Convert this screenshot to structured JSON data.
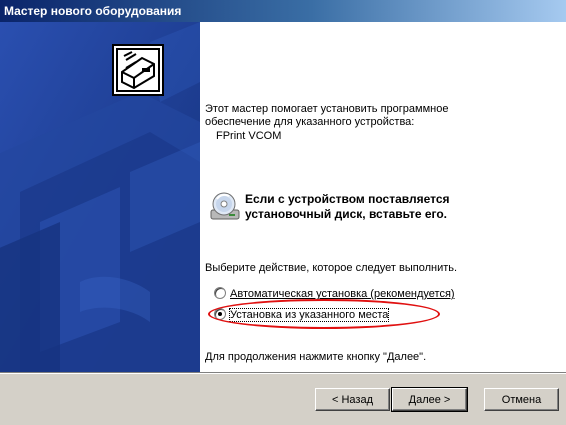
{
  "window": {
    "title": "Мастер нового оборудования"
  },
  "intro": {
    "line1": "Этот мастер помогает установить программное",
    "line2": "обеспечение для указанного устройства:",
    "device": "FPrint VCOM"
  },
  "disk_hint": {
    "line1": "Если с устройством поставляется",
    "line2": "установочный диск, вставьте его."
  },
  "choose_prompt": "Выберите действие, которое следует выполнить.",
  "options": [
    {
      "label": "Автоматическая установка (рекомендуется)",
      "selected": false
    },
    {
      "label": "Установка из указанного места",
      "selected": true
    }
  ],
  "continue_hint": "Для продолжения нажмите кнопку \"Далее\".",
  "buttons": {
    "back": "< Назад",
    "next": "Далее >",
    "cancel": "Отмена"
  },
  "colors": {
    "titlebar": "#0a246a",
    "sidebar": "#1f3f96",
    "highlight_ellipse": "#e01010",
    "dialog_face": "#d4d0c8"
  },
  "icons": [
    "hardware-wizard-icon",
    "cd-disk-icon"
  ]
}
